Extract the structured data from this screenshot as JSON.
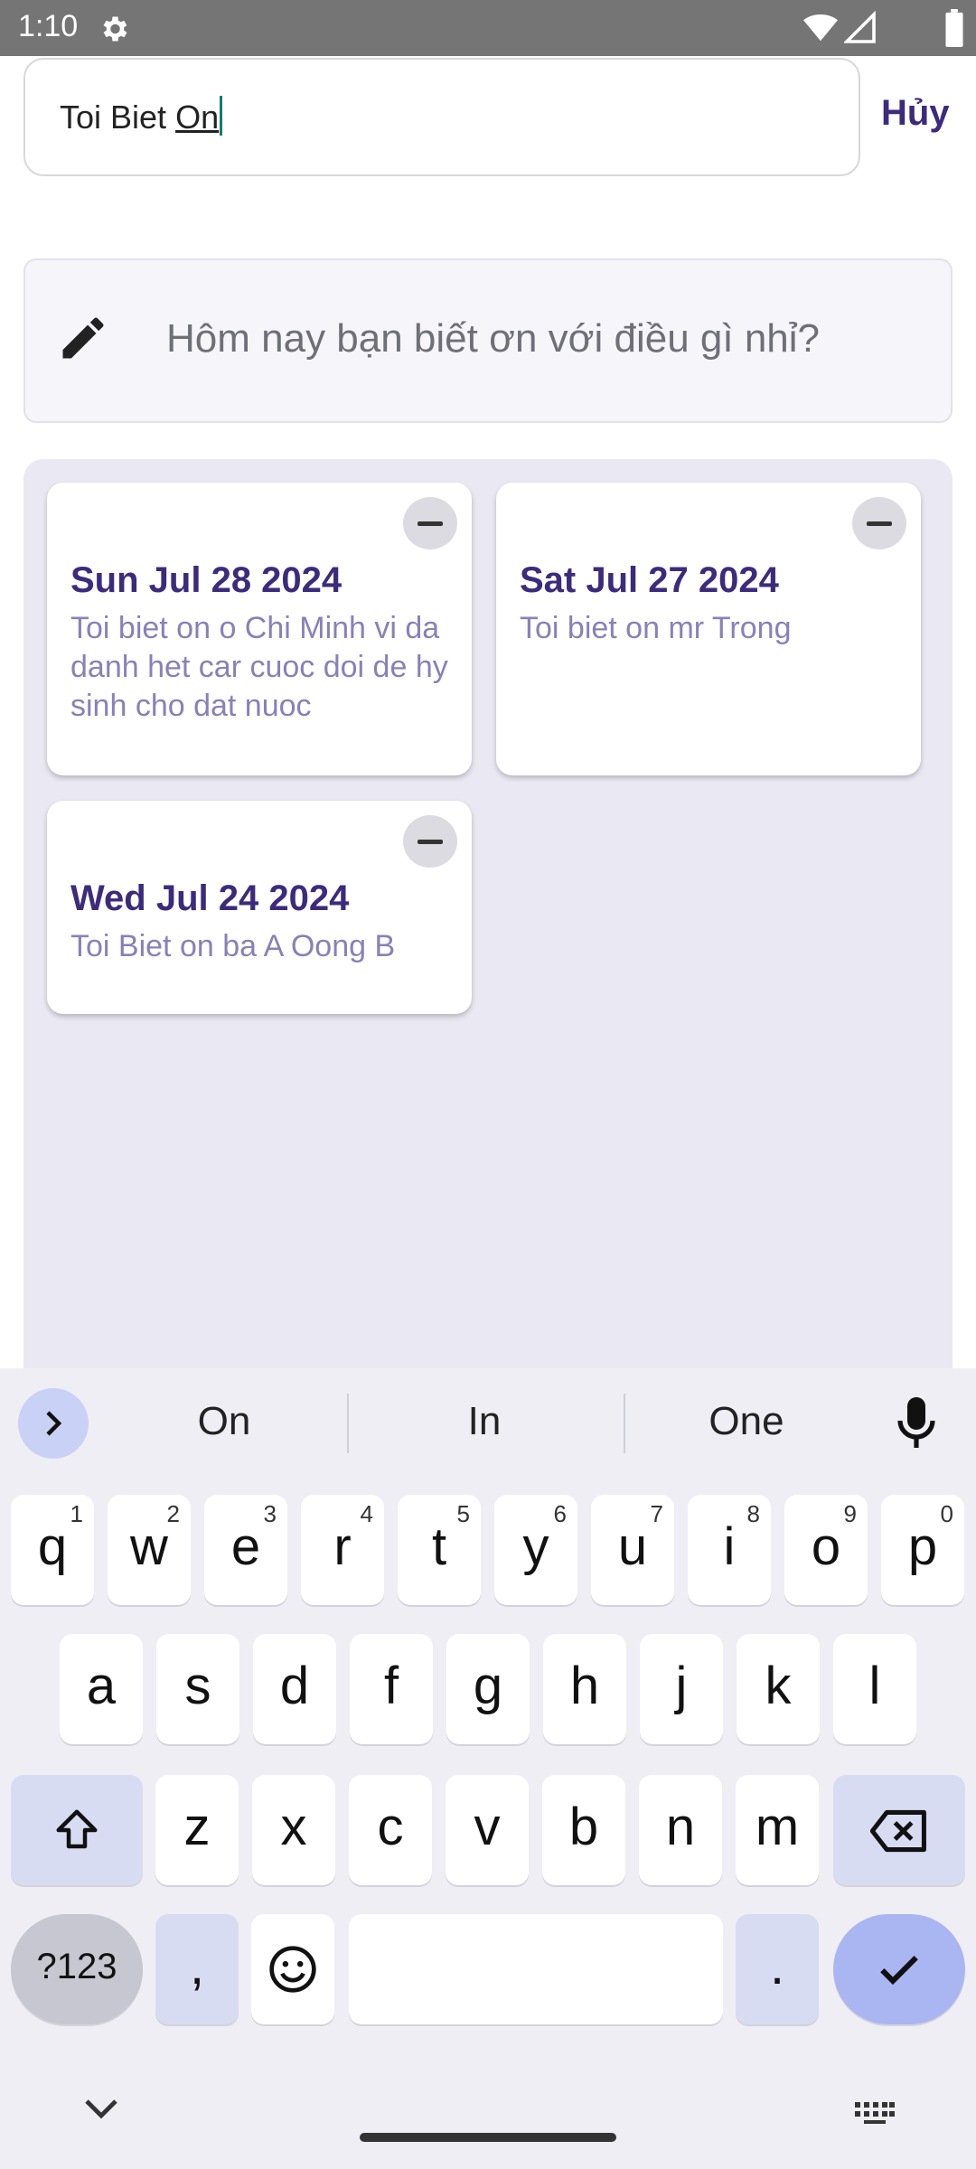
{
  "status_bar": {
    "time": "1:10",
    "icons": [
      "gear-icon",
      "wifi-icon",
      "signal-icon",
      "battery-icon"
    ]
  },
  "search": {
    "value_prefix": "Toi Biet ",
    "value_composing": "On",
    "cancel_label": "Hủy"
  },
  "prompt": {
    "icon": "pencil-icon",
    "text": "Hôm nay bạn biết ơn với điều gì nhỉ?"
  },
  "entries": [
    {
      "date": "Sun Jul 28 2024",
      "text": "Toi biet on o Chi Minh vi da danh het car cuoc doi de hy sinh cho dat nuoc"
    },
    {
      "date": "Sat Jul 27 2024",
      "text": "Toi biet on mr Trong"
    },
    {
      "date": "Wed Jul 24 2024",
      "text": "Toi Biet on ba A Oong B"
    }
  ],
  "keyboard": {
    "suggestions": [
      "On",
      "In",
      "One"
    ],
    "row1": [
      {
        "k": "q",
        "h": "1"
      },
      {
        "k": "w",
        "h": "2"
      },
      {
        "k": "e",
        "h": "3"
      },
      {
        "k": "r",
        "h": "4"
      },
      {
        "k": "t",
        "h": "5"
      },
      {
        "k": "y",
        "h": "6"
      },
      {
        "k": "u",
        "h": "7"
      },
      {
        "k": "i",
        "h": "8"
      },
      {
        "k": "o",
        "h": "9"
      },
      {
        "k": "p",
        "h": "0"
      }
    ],
    "row2": [
      "a",
      "s",
      "d",
      "f",
      "g",
      "h",
      "j",
      "k",
      "l"
    ],
    "row3": [
      "z",
      "x",
      "c",
      "v",
      "b",
      "n",
      "m"
    ],
    "symbols_label": "?123",
    "comma": ",",
    "period": "."
  },
  "colors": {
    "accent": "#3c2b7d",
    "entry_text": "#8a80b8",
    "status_bar": "#757575",
    "keyboard_accent": "#aab6f2"
  }
}
